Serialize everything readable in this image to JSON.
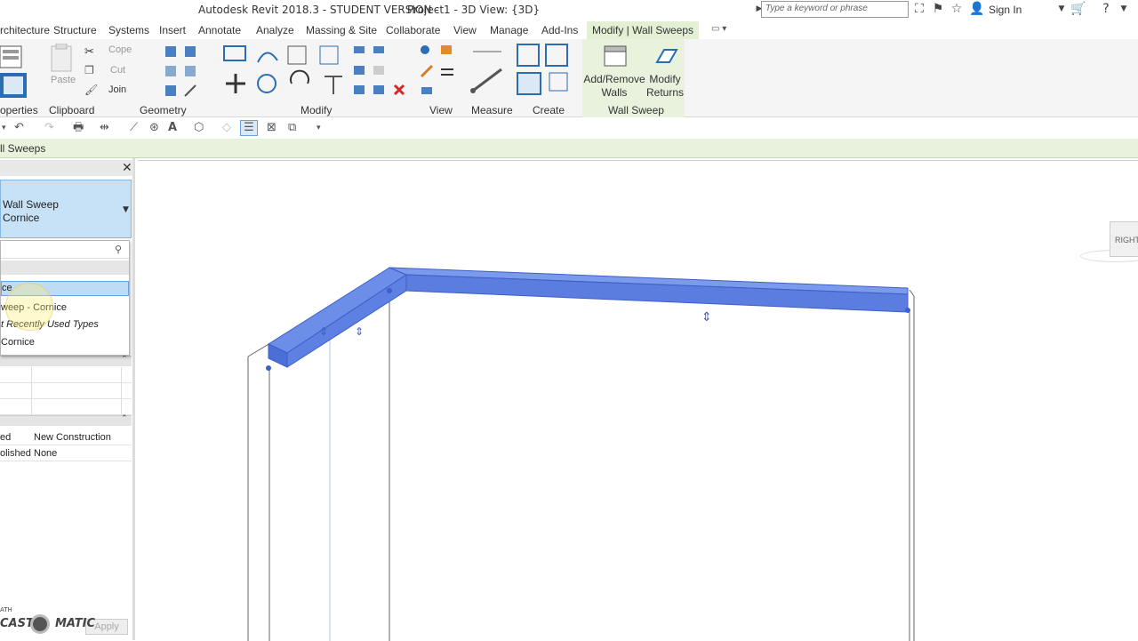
{
  "window": {
    "title": "Autodesk Revit 2018.3 - STUDENT VERSION -",
    "project_view": "Project1 - 3D View: {3D}",
    "search_placeholder": "Type a keyword or phrase",
    "sign_in": "Sign In"
  },
  "tabs": [
    {
      "label": "rchitecture"
    },
    {
      "label": "Structure"
    },
    {
      "label": "Systems"
    },
    {
      "label": "Insert"
    },
    {
      "label": "Annotate"
    },
    {
      "label": "Analyze"
    },
    {
      "label": "Massing & Site"
    },
    {
      "label": "Collaborate"
    },
    {
      "label": "View"
    },
    {
      "label": "Manage"
    },
    {
      "label": "Add-Ins"
    },
    {
      "label": "Modify | Wall Sweeps"
    }
  ],
  "ribbon": {
    "copy": "Cope",
    "cut": "Cut",
    "paste": "Paste",
    "join": "Join",
    "add_remove_walls": "Add/Remove Walls",
    "modify_returns": "Modify Returns",
    "panels": {
      "properties": "operties",
      "clipboard": "Clipboard",
      "geometry": "Geometry",
      "modify": "Modify",
      "view": "View",
      "measure": "Measure",
      "create": "Create",
      "wall_sweep": "Wall Sweep"
    }
  },
  "context_bar": "ll Sweeps",
  "properties": {
    "type_line1": "Wall Sweep",
    "type_line2": "Cornice",
    "dropdown": {
      "selected": "ce",
      "item1": "weep - Cornice",
      "section": "t Recently Used Types",
      "item2": " Cornice"
    },
    "rows": [
      {
        "key": "ed",
        "value": "New Construction"
      },
      {
        "key": "olished",
        "value": "None"
      }
    ],
    "apply": "Apply"
  },
  "watermark": {
    "small": "ATH",
    "brand_left": "CAST",
    "brand_right": "MATIC"
  },
  "viewcube": {
    "face": "RIGHT"
  },
  "colors": {
    "accent_green": "#e3f0d5",
    "selection_blue": "#5b7de0",
    "type_selector": "#c7e1f7"
  }
}
